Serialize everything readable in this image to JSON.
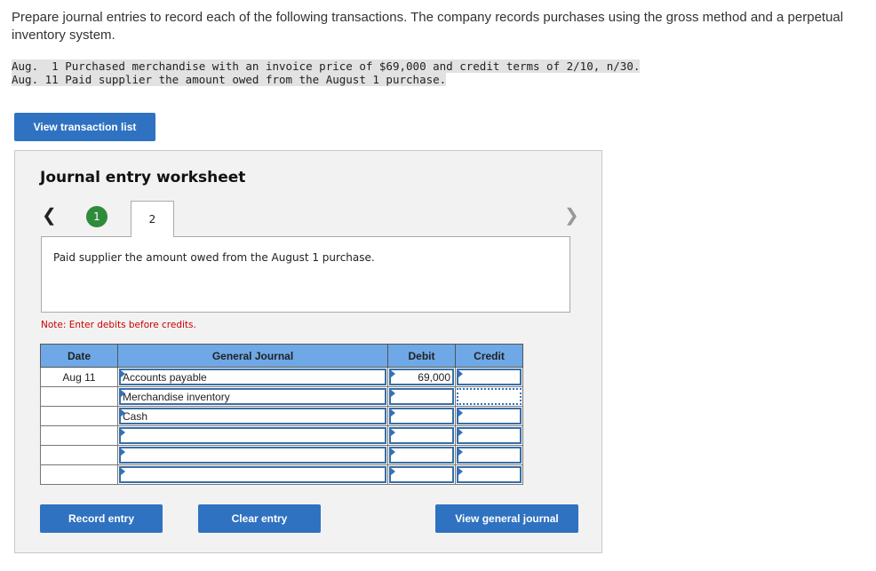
{
  "instructions": "Prepare journal entries to record each of the following transactions. The company records purchases using the gross method and a perpetual inventory system.",
  "transactions": [
    "Aug.  1 Purchased merchandise with an invoice price of $69,000 and credit terms of 2/10, n/30.",
    "Aug. 11 Paid supplier the amount owed from the August 1 purchase."
  ],
  "buttons": {
    "view_transaction_list": "View transaction list",
    "record_entry": "Record entry",
    "clear_entry": "Clear entry",
    "view_general_journal": "View general journal"
  },
  "worksheet": {
    "title": "Journal entry worksheet",
    "prev_icon": "chevron-left-icon",
    "next_icon": "chevron-right-icon",
    "steps": [
      {
        "label": "1",
        "status": "completed"
      },
      {
        "label": "2",
        "status": "active"
      }
    ],
    "description": "Paid supplier the amount owed from the August 1 purchase.",
    "note": "Note: Enter debits before credits."
  },
  "journal": {
    "headers": [
      "Date",
      "General Journal",
      "Debit",
      "Credit"
    ],
    "rows": [
      {
        "date": "Aug 11",
        "account": "Accounts payable",
        "debit": "69,000",
        "credit": ""
      },
      {
        "date": "",
        "account": "Merchandise inventory",
        "debit": "",
        "credit": ""
      },
      {
        "date": "",
        "account": "Cash",
        "debit": "",
        "credit": ""
      },
      {
        "date": "",
        "account": "",
        "debit": "",
        "credit": ""
      },
      {
        "date": "",
        "account": "",
        "debit": "",
        "credit": ""
      },
      {
        "date": "",
        "account": "",
        "debit": "",
        "credit": ""
      }
    ]
  },
  "colors": {
    "button_blue": "#2f72c1",
    "header_blue": "#6ea8e6",
    "step_green": "#2e8b3a",
    "note_red": "#cc0000"
  }
}
